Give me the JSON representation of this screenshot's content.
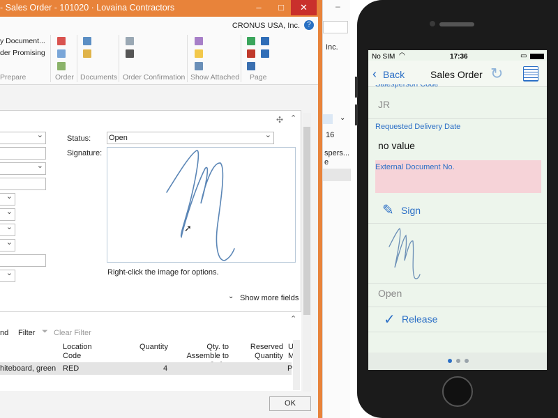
{
  "nav_window": {
    "title": "- Sales Order - 101020 · Lovaina Contractors",
    "window_buttons": {
      "minimize": "–",
      "restore": "□",
      "close": "✕"
    },
    "company": "CRONUS USA, Inc.",
    "help": "?",
    "ribbon": {
      "copy_document": "y Document...",
      "order_promising": "der Promising",
      "groups": [
        "Prepare",
        "Order",
        "Documents",
        "Order Confirmation",
        "Show Attached",
        "Page"
      ]
    },
    "general": {
      "status_label": "Status:",
      "status_value": "Open",
      "signature_label": "Signature:",
      "signature_hint": "Right-click the image for options.",
      "show_more": "Show more fields"
    },
    "lines": {
      "toolbar_find": "nd",
      "toolbar_filter": "Filter",
      "toolbar_clear_filter": "Clear Filter",
      "columns": [
        "Location Code",
        "Quantity",
        "Qty. to Assemble to Order",
        "Reserved Quantity",
        "U M"
      ],
      "rows": [
        {
          "description": "hiteboard, green",
          "location": "RED",
          "quantity": "4",
          "qty_assemble": "",
          "reserved": "",
          "um": "P"
        }
      ]
    },
    "ok_button": "OK"
  },
  "background_window": {
    "company_fragment": "Inc.",
    "date_fragment": "16",
    "col_fragment_1": "spers...",
    "col_fragment_2": "e"
  },
  "phone": {
    "status_bar": {
      "carrier": "No SIM",
      "time": "17:36"
    },
    "nav": {
      "back": "Back",
      "title": "Sales Order"
    },
    "fields": {
      "salesperson_label": "Salesperson Code",
      "salesperson_value": "JR",
      "requested_delivery_label": "Requested Delivery Date",
      "requested_delivery_value": "no value",
      "external_doc_label": "External Document No."
    },
    "sign_label": "Sign",
    "status_value": "Open",
    "release_label": "Release",
    "colors": {
      "accent": "#2b6fc6",
      "error_field": "#f6d3d8",
      "screen_bg": "#edf5ec"
    }
  }
}
